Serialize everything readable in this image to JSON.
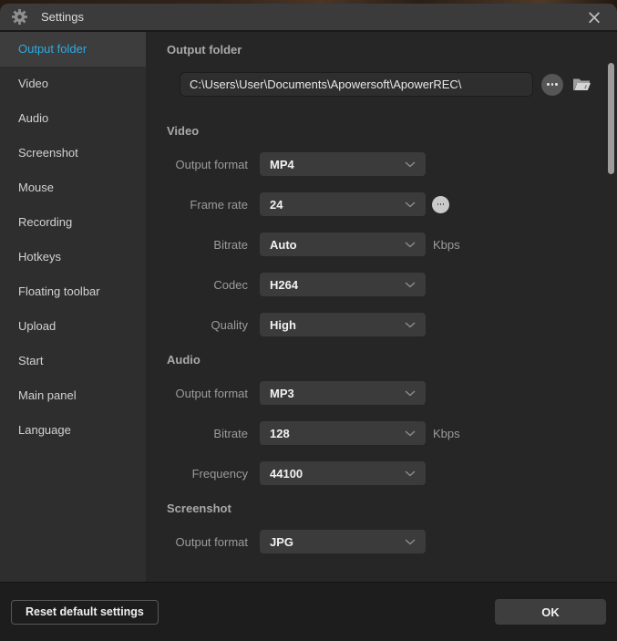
{
  "window": {
    "title": "Settings"
  },
  "icons": {
    "close_glyph": "×",
    "gear": "gear-icon",
    "ellipsis": "three-dots",
    "folder": "open-folder",
    "chevron": "chevron-down"
  },
  "colors": {
    "accent_selected": "#2eaadf",
    "titlebar_bg": "#3b3b3b",
    "sidebar_bg": "#2e2e2e",
    "content_bg": "#262626",
    "dropdown_bg": "#3b3b3b",
    "footer_bg": "#1d1d1d"
  },
  "sidebar": {
    "items": [
      {
        "label": "Output folder",
        "selected": true
      },
      {
        "label": "Video",
        "selected": false
      },
      {
        "label": "Audio",
        "selected": false
      },
      {
        "label": "Screenshot",
        "selected": false
      },
      {
        "label": "Mouse",
        "selected": false
      },
      {
        "label": "Recording",
        "selected": false
      },
      {
        "label": "Hotkeys",
        "selected": false
      },
      {
        "label": "Floating toolbar",
        "selected": false
      },
      {
        "label": "Upload",
        "selected": false
      },
      {
        "label": "Start",
        "selected": false
      },
      {
        "label": "Main panel",
        "selected": false
      },
      {
        "label": "Language",
        "selected": false
      }
    ]
  },
  "sections": {
    "output_folder": {
      "header": "Output folder",
      "path_value": "C:\\Users\\User\\Documents\\Apowersoft\\ApowerREC\\"
    },
    "video": {
      "header": "Video",
      "rows": [
        {
          "label": "Output format",
          "value": "MP4"
        },
        {
          "label": "Frame rate",
          "value": "24"
        },
        {
          "label": "Bitrate",
          "value": "Auto",
          "suffix": "Kbps"
        },
        {
          "label": "Codec",
          "value": "H264"
        },
        {
          "label": "Quality",
          "value": "High"
        }
      ]
    },
    "audio": {
      "header": "Audio",
      "rows": [
        {
          "label": "Output format",
          "value": "MP3"
        },
        {
          "label": "Bitrate",
          "value": "128",
          "suffix": "Kbps"
        },
        {
          "label": "Frequency",
          "value": "44100"
        }
      ]
    },
    "screenshot": {
      "header": "Screenshot",
      "rows": [
        {
          "label": "Output format",
          "value": "JPG"
        }
      ]
    }
  },
  "footer": {
    "reset_label": "Reset default settings",
    "ok_label": "OK"
  }
}
